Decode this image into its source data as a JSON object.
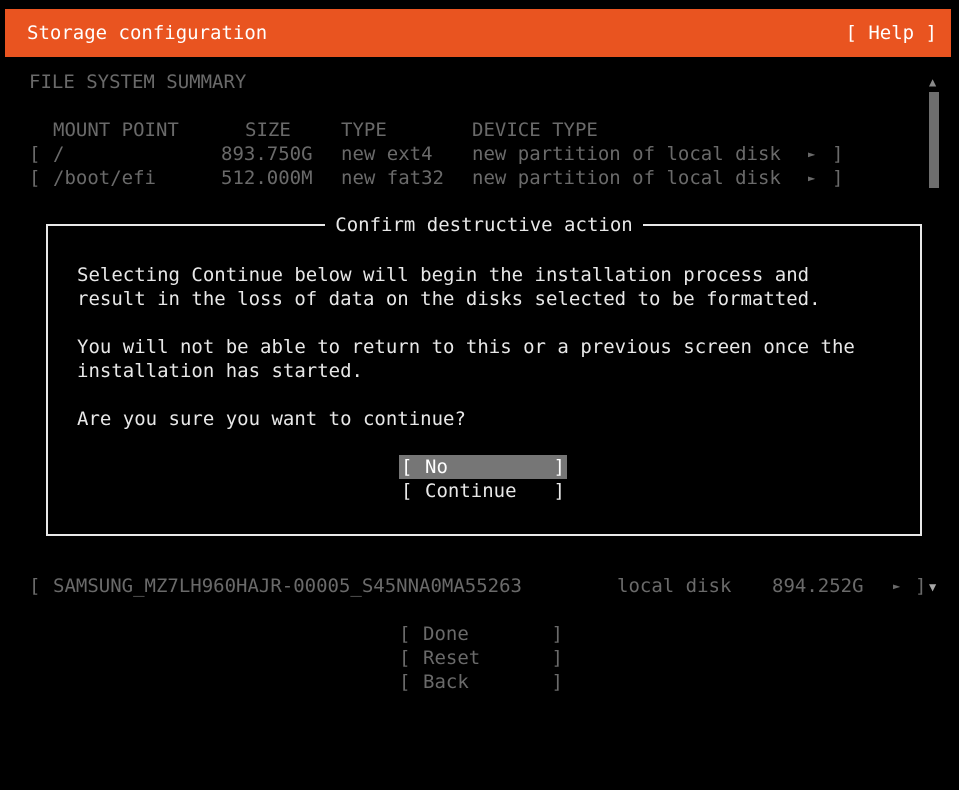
{
  "header": {
    "title": "Storage configuration",
    "help_label": "[ Help ]",
    "background_color": "#e95420"
  },
  "summary": {
    "heading": "FILE SYSTEM SUMMARY",
    "columns": {
      "mount_point": "MOUNT POINT",
      "size": "SIZE",
      "type": "TYPE",
      "device_type": "DEVICE TYPE"
    },
    "rows": [
      {
        "open_bracket": "[",
        "mount_point": "/",
        "size": "893.750G",
        "type": "new ext4",
        "device_type": "new partition of local disk",
        "arrow": "►",
        "close_bracket": "]"
      },
      {
        "open_bracket": "[",
        "mount_point": "/boot/efi",
        "size": "512.000M",
        "type": "new fat32",
        "device_type": "new partition of local disk",
        "arrow": "►",
        "close_bracket": "]"
      }
    ]
  },
  "disk": {
    "open_bracket": "[",
    "name": "SAMSUNG_MZ7LH960HAJR-00005_S45NNA0MA55263",
    "kind": "local disk",
    "size": "894.252G",
    "arrow": "►",
    "close_bracket": "]"
  },
  "scrollbar": {
    "up_icon": "▲",
    "down_icon": "▼"
  },
  "dialog": {
    "title": "Confirm destructive action",
    "para1_line1": "Selecting Continue below will begin the installation process and",
    "para1_line2": "result in the loss of data on the disks selected to be formatted.",
    "para2_line1": "You will not be able to return to this or a previous screen once the",
    "para2_line2": "installation has started.",
    "question": "Are you sure you want to continue?",
    "buttons": {
      "no": "No",
      "continue": "Continue"
    }
  },
  "footer_buttons": {
    "done": "Done",
    "reset": "Reset",
    "back": "Back"
  },
  "bracket_open": "[",
  "bracket_close": "]"
}
